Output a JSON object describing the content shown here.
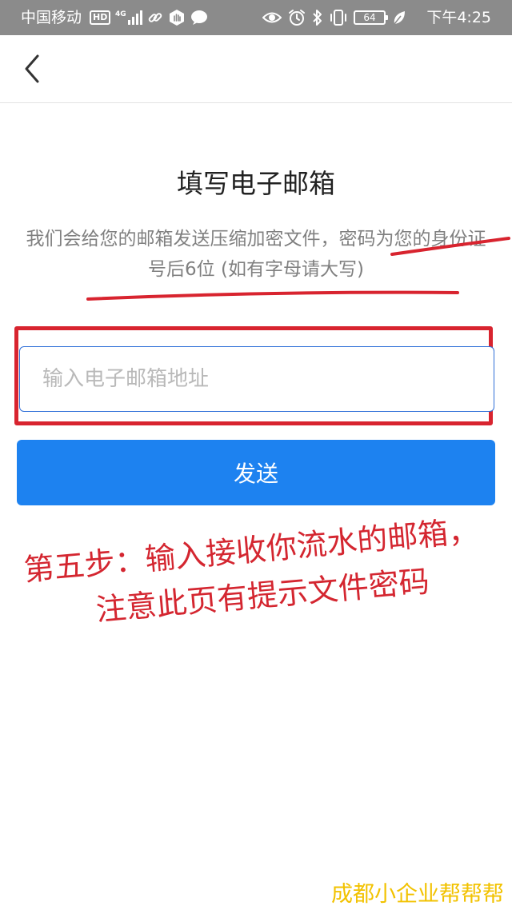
{
  "status_bar": {
    "carrier": "中国移动",
    "network_badge": "HD",
    "signal_type": "4G",
    "battery_level": "64",
    "time": "下午4:25",
    "icons": [
      "hd-badge-icon",
      "signal-icon",
      "link-icon",
      "hand-icon",
      "chat-icon",
      "eye-icon",
      "alarm-icon",
      "bluetooth-icon",
      "vibrate-icon",
      "battery-icon",
      "leaf-icon"
    ]
  },
  "nav": {
    "back_icon": "chevron-left-icon"
  },
  "page": {
    "title": "填写电子邮箱",
    "description": "我们会给您的邮箱发送压缩加密文件，密码为您的身份证号后6位 (如有字母请大写)"
  },
  "form": {
    "email_placeholder": "输入电子邮箱地址",
    "email_value": "",
    "send_label": "发送"
  },
  "annotation": {
    "line1": "第五步：输入接收你流水的邮箱，",
    "line2": "注意此页有提示文件密码",
    "color": "#d42630"
  },
  "watermark": {
    "text": "成都小企业帮帮帮",
    "color": "#f2c200"
  },
  "colors": {
    "accent": "#1d82f0",
    "input_border": "#2f6fd8",
    "status_bar_bg": "#8b8b8b",
    "highlight_red": "#d8242f"
  }
}
